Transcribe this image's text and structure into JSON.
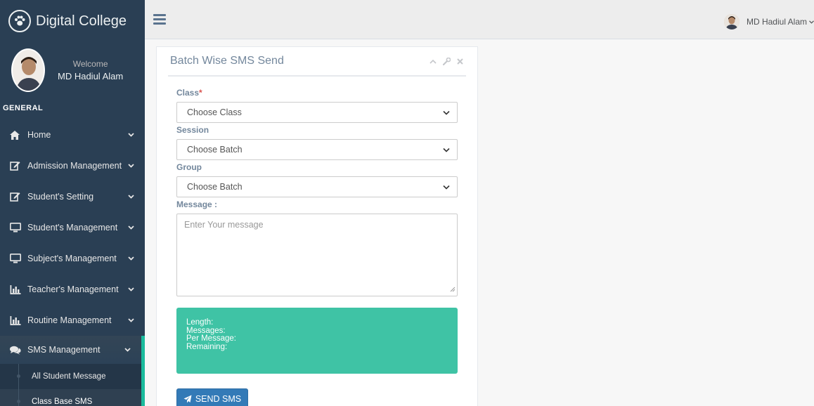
{
  "brand": {
    "name": "Digital College",
    "icon": "paw-icon"
  },
  "profile": {
    "welcome": "Welcome",
    "name": "MD Hadiul Alam"
  },
  "sidebar": {
    "section": "GENERAL",
    "items": [
      {
        "label": "Home",
        "icon": "home-icon"
      },
      {
        "label": "Admission Management",
        "icon": "edit-icon"
      },
      {
        "label": "Student's Setting",
        "icon": "edit-icon"
      },
      {
        "label": "Student's Management",
        "icon": "desktop-icon"
      },
      {
        "label": "Subject's Management",
        "icon": "desktop-icon"
      },
      {
        "label": "Teacher's Management",
        "icon": "bar-chart-icon"
      },
      {
        "label": "Routine Management",
        "icon": "bar-chart-icon"
      },
      {
        "label": "SMS Management",
        "icon": "comments-icon"
      }
    ],
    "sms_submenu": [
      {
        "label": "All Student Message"
      },
      {
        "label": "Class Base SMS"
      }
    ]
  },
  "topnav": {
    "user_name": "MD Hadiul Alam"
  },
  "panel": {
    "title": "Batch Wise SMS Send",
    "class_label": "Class",
    "required_mark": "*",
    "class_value": "Choose Class",
    "session_label": "Session",
    "session_value": "Choose Batch",
    "group_label": "Group",
    "group_value": "Choose Batch",
    "message_label": "Message :",
    "message_placeholder": "Enter Your message",
    "counter": {
      "length": "Length:",
      "messages": "Messages:",
      "per_message": "Per Message:",
      "remaining": "Remaining:"
    },
    "send_label": "SEND SMS"
  },
  "colors": {
    "sidebar": "#2a3f54",
    "accent": "#1abb9c",
    "counter_bg": "#3fc3a5",
    "primary": "#337ab7"
  }
}
